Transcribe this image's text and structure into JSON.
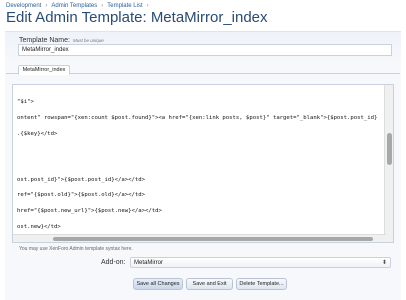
{
  "breadcrumb": {
    "items": [
      "Development",
      "Admin Templates",
      "Template List"
    ],
    "sep": "›"
  },
  "page": {
    "title_prefix": "Edit Admin Template:",
    "title_name": "MetaMirror_index"
  },
  "form": {
    "template_name_label": "Template Name:",
    "template_name_hint": "Must be unique",
    "template_name_value": "MetaMirror_index",
    "tab_label": "MetaMirror_index",
    "syntax_note": "You may use XenForo Admin template syntax here.",
    "addon_label": "Add-on:",
    "addon_value": "MetaMirror"
  },
  "editor": {
    "lines": [
      "\"$i\">",
      "ontent\" rowspan=\"{xen:count $post.found}\"><a href=\"{xen:link posts, $post}\" target=\"_blank\">{$post.post_id}",
      ".{$key}</td>",
      "ost.post_id}\">{$post.post_id}</a></td>",
      "ref=\"{$post.old}\">{$post.old}</a></td>",
      "href=\"{$post.new_url}\">{$post.new}</a></td>",
      "ost.new}</td>"
    ]
  },
  "buttons": {
    "save_all": "Save all Changes",
    "save_exit": "Save and Exit",
    "delete": "Delete Template..."
  }
}
